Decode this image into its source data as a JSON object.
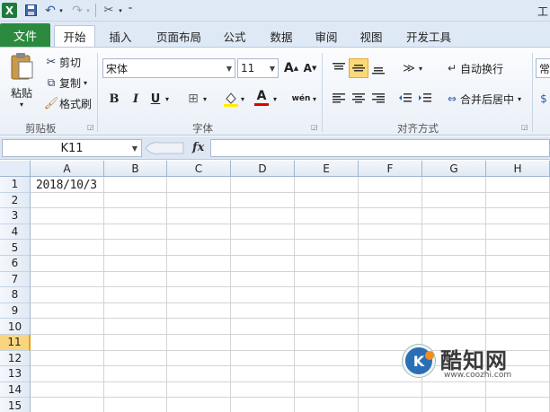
{
  "app": {
    "logo": "X",
    "title": "工",
    "qat_icons": [
      "save-icon",
      "undo-icon",
      "redo-icon",
      "customize-icon"
    ]
  },
  "tabs": {
    "file": "文件",
    "items": [
      "开始",
      "插入",
      "页面布局",
      "公式",
      "数据",
      "审阅",
      "视图",
      "开发工具"
    ],
    "active": "开始"
  },
  "clipboard": {
    "paste": "粘贴",
    "cut": "剪切",
    "copy": "复制",
    "format_painter": "格式刷",
    "group_label": "剪贴板"
  },
  "font": {
    "name": "宋体",
    "size": "11",
    "bold": "B",
    "italic": "I",
    "underline": "U",
    "font_color_letter": "A",
    "phonetic": "wén",
    "group_label": "字体"
  },
  "alignment": {
    "wrap_text": "自动换行",
    "merge_center": "合并后居中",
    "group_label": "对齐方式"
  },
  "number": {
    "format": "常"
  },
  "formula_bar": {
    "name_box": "K11",
    "fx": "fx",
    "value": ""
  },
  "sheet": {
    "columns": [
      "A",
      "B",
      "C",
      "D",
      "E",
      "F",
      "G",
      "H"
    ],
    "rows": [
      "1",
      "2",
      "3",
      "4",
      "5",
      "6",
      "7",
      "8",
      "9",
      "10",
      "11",
      "12",
      "13",
      "14",
      "15"
    ],
    "selected_row": "11",
    "cell_A1": "2018/10/3"
  },
  "watermark": {
    "name": "酷知网",
    "url": "www.coozhi.com",
    "logo_letter": "K"
  },
  "colors": {
    "file_tab": "#2b8a3e",
    "selected_row_header": "#f9d67e",
    "ribbon_bg": "#eaf0f8"
  }
}
